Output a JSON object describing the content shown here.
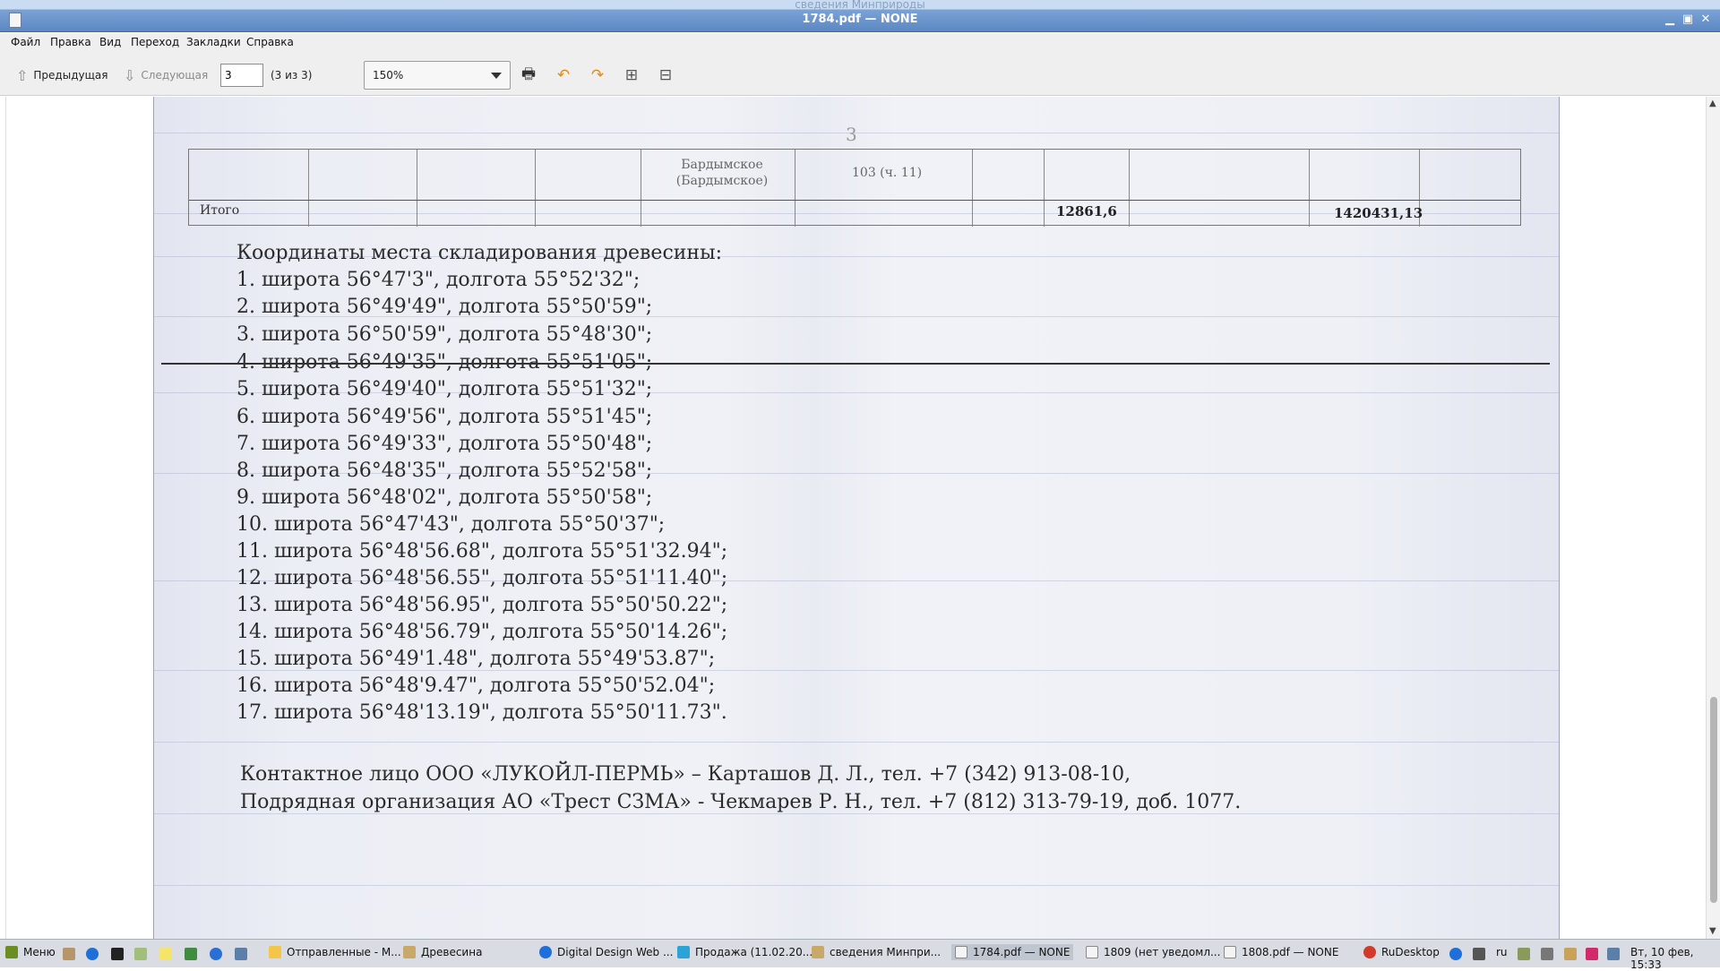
{
  "window": {
    "title": "1784.pdf — NONE",
    "ghost_title": "сведения Минприроды"
  },
  "menu": [
    "Файл",
    "Правка",
    "Вид",
    "Переход",
    "Закладки",
    "Справка"
  ],
  "toolbar": {
    "prev_label": "Предыдущая",
    "next_label": "Следующая",
    "page_value": "3",
    "page_count": "(3 из 3)",
    "zoom": "150%"
  },
  "document": {
    "page_number": "3",
    "table": {
      "cell_name": "Бардымское\n(Бардымское)",
      "cell_quarter": "103 (ч. 11)",
      "total_label": "Итого",
      "total_volume": "12861,6",
      "total_sum": "1420431,13"
    },
    "heading": "Координаты места складирования древесины:",
    "coords": [
      "1. широта 56°47'3\", долгота 55°52'32\";",
      "2. широта 56°49'49\", долгота 55°50'59\";",
      "3. широта 56°50'59\", долгота 55°48'30\";",
      "4. широта 56°49'35\", долгота 55°51'05\";",
      "5. широта 56°49'40\", долгота 55°51'32\";",
      "6. широта 56°49'56\", долгота 55°51'45\";",
      "7. широта 56°49'33\", долгота 55°50'48\";",
      "8. широта 56°48'35\", долгота 55°52'58\";",
      "9. широта 56°48'02\", долгота 55°50'58\";",
      "10. широта 56°47'43\", долгота 55°50'37\";",
      "11. широта 56°48'56.68\", долгота 55°51'32.94\";",
      "12. широта 56°48'56.55\", долгота 55°51'11.40\";",
      "13. широта 56°48'56.95\", долгота 55°50'50.22\";",
      "14. широта 56°48'56.79\", долгота 55°50'14.26\";",
      "15. широта 56°49'1.48\", долгота 55°49'53.87\";",
      "16. широта 56°48'9.47\", долгота 55°50'52.04\";",
      "17. широта 56°48'13.19\", долгота 55°50'11.73\"."
    ],
    "contact_1": "Контактное лицо ООО «ЛУКОЙЛ-ПЕРМЬ» – Карташов Д. Л., тел. +7 (342) 913-08-10,",
    "contact_2": "Подрядная организация АО «Трест СЗМА» - Чекмарев Р. Н., тел. +7 (812) 313-79-19, доб. 1077."
  },
  "taskbar": {
    "menu_label": "Меню",
    "tasks": [
      "Отправленные - М...",
      "Древесина",
      "Digital Design Web ...",
      "Продажа (11.02.20...",
      "сведения Минпри...",
      "1784.pdf — NONE",
      "1809 (нет уведомл...",
      "1808.pdf — NONE",
      "RuDesktop"
    ],
    "lang": "ru",
    "clock": "Вт, 10 фев, 15:33"
  }
}
